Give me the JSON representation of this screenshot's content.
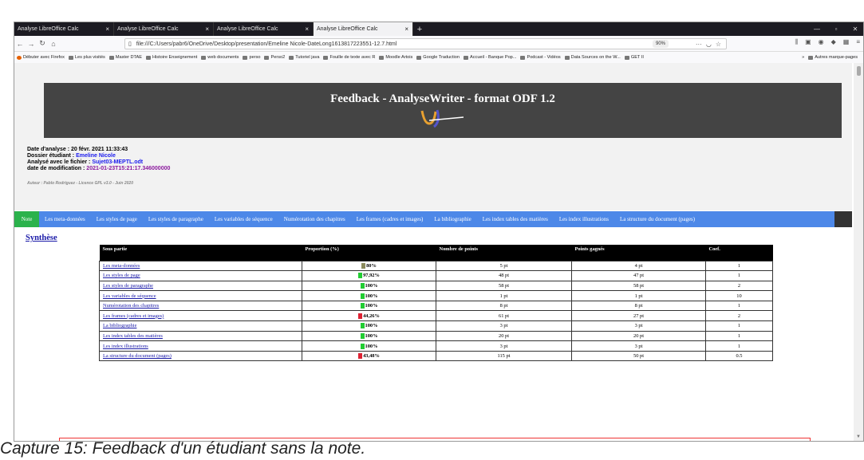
{
  "browser": {
    "tabs": [
      {
        "label": "Analyse LibreOffice Calc",
        "active": false
      },
      {
        "label": "Analyse LibreOffice Calc",
        "active": false
      },
      {
        "label": "Analyse LibreOffice Calc",
        "active": false
      },
      {
        "label": "Analyse LibreOffice Calc",
        "active": true
      }
    ],
    "tab_close": "×",
    "new_tab": "+",
    "url": "file:///C:/Users/pabr6/OneDrive/Desktop/presentation/Emeline Nicole-DateLong1613817223551-12.7.html",
    "zoom": "90%",
    "bookmarks": [
      "Débuter avec Firefox",
      "Les plus visités",
      "Master DTAE",
      "Histoire Enseignement",
      "web documents",
      "perso",
      "Perso2",
      "Tutoriel java",
      "Fouille de texte avec R",
      "Moodle Artois",
      "Google Traduction",
      "Accueil - Banque Pop...",
      "Podcast - Vidéos",
      "Data Sources on the W...",
      "GET II"
    ],
    "bookmarks_overflow": "»",
    "bookmarks_other": "Autres marque-pages"
  },
  "page": {
    "banner_title": "Feedback - AnalyseWriter - format ODF 1.2",
    "meta": {
      "date_label": "Date d'analyse : ",
      "date_value": "20 févr. 2021 11:33:43",
      "folder_label": "Dossier étudiant : ",
      "folder_value": "Emeline Nicole",
      "file_label": "Analysé avec le fichier : ",
      "file_value": "Sujet03-MEPTL.odt",
      "mod_label": "date de modification : ",
      "mod_value": "2021-01-23T15:21:17.346000000"
    },
    "author": "Auteur : Pablo Rodriguez - Licence GPL v3.0 - Juin 2020",
    "menu": [
      "Note",
      "Les meta-données",
      "Les styles de page",
      "Les styles de paragraphe",
      "Les variables de séquence",
      "Numérotation des chapitres",
      "Les frames (cadres et images)",
      "La bibliographie",
      "Les index tables des matières",
      "Les index illustrations",
      "La structure du document (pages)"
    ],
    "section_title": "Synthèse",
    "table": {
      "headers": [
        "Sous partie",
        "Proportion (%)",
        "Nombre de points",
        "Points gagnés",
        "Coef."
      ],
      "rows": [
        {
          "name": "Les meta-données",
          "pct": "80%",
          "value": 80,
          "color": "#8a8a5c",
          "points": "5 pt",
          "gained": "4 pt",
          "coef": "1"
        },
        {
          "name": "Les styles de page",
          "pct": "97,92%",
          "value": 97.92,
          "color": "#22cc33",
          "points": "48 pt",
          "gained": "47 pt",
          "coef": "1"
        },
        {
          "name": "Les styles de paragraphe",
          "pct": "100%",
          "value": 100,
          "color": "#22cc33",
          "points": "58 pt",
          "gained": "58 pt",
          "coef": "2"
        },
        {
          "name": "Les variables de séquence",
          "pct": "100%",
          "value": 100,
          "color": "#22cc33",
          "points": "1 pt",
          "gained": "1 pt",
          "coef": "10"
        },
        {
          "name": "Numérotation des chapitres",
          "pct": "100%",
          "value": 100,
          "color": "#22cc33",
          "points": "8 pt",
          "gained": "8 pt",
          "coef": "1"
        },
        {
          "name": "Les frames (cadres et images)",
          "pct": "44,26%",
          "value": 44.26,
          "color": "#dd2233",
          "points": "61 pt",
          "gained": "27 pt",
          "coef": "2"
        },
        {
          "name": "La bibliographie",
          "pct": "100%",
          "value": 100,
          "color": "#22cc33",
          "points": "3 pt",
          "gained": "3 pt",
          "coef": "1"
        },
        {
          "name": "Les index tables des matières",
          "pct": "100%",
          "value": 100,
          "color": "#22cc33",
          "points": "20 pt",
          "gained": "20 pt",
          "coef": "1"
        },
        {
          "name": "Les index illustrations",
          "pct": "100%",
          "value": 100,
          "color": "#22cc33",
          "points": "3 pt",
          "gained": "3 pt",
          "coef": "1"
        },
        {
          "name": "La structure du document (pages)",
          "pct": "43,48%",
          "value": 43.48,
          "color": "#dd2233",
          "points": "115 pt",
          "gained": "50 pt",
          "coef": "0.5"
        }
      ]
    }
  },
  "caption": "Capture 15: Feedback d'un étudiant sans la note."
}
